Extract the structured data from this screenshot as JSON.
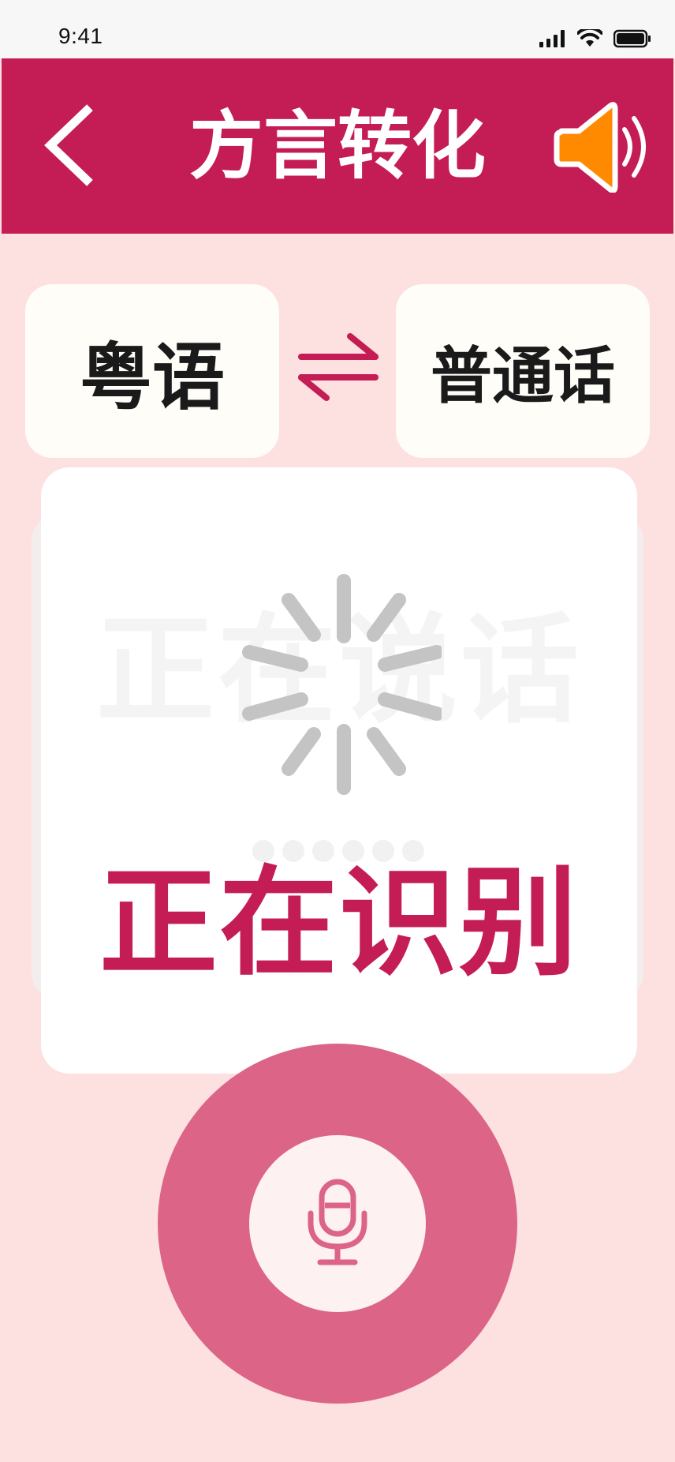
{
  "status_bar": {
    "time": "9:41"
  },
  "header": {
    "title": "方言转化",
    "back_icon": "chevron-left-icon",
    "speaker_icon": "speaker-icon",
    "background_color": "#c41c54",
    "speaker_color": "#ff8a00"
  },
  "languages": {
    "source": "粤语",
    "target": "普通话",
    "swap_icon": "swap-arrows-icon"
  },
  "dialog": {
    "ghost_text": "正在说话",
    "status": "正在识别",
    "spinner_icon": "loading-spinner-icon",
    "status_color": "#c41c54"
  },
  "mic": {
    "icon": "microphone-icon",
    "accent_color": "#db6487"
  }
}
